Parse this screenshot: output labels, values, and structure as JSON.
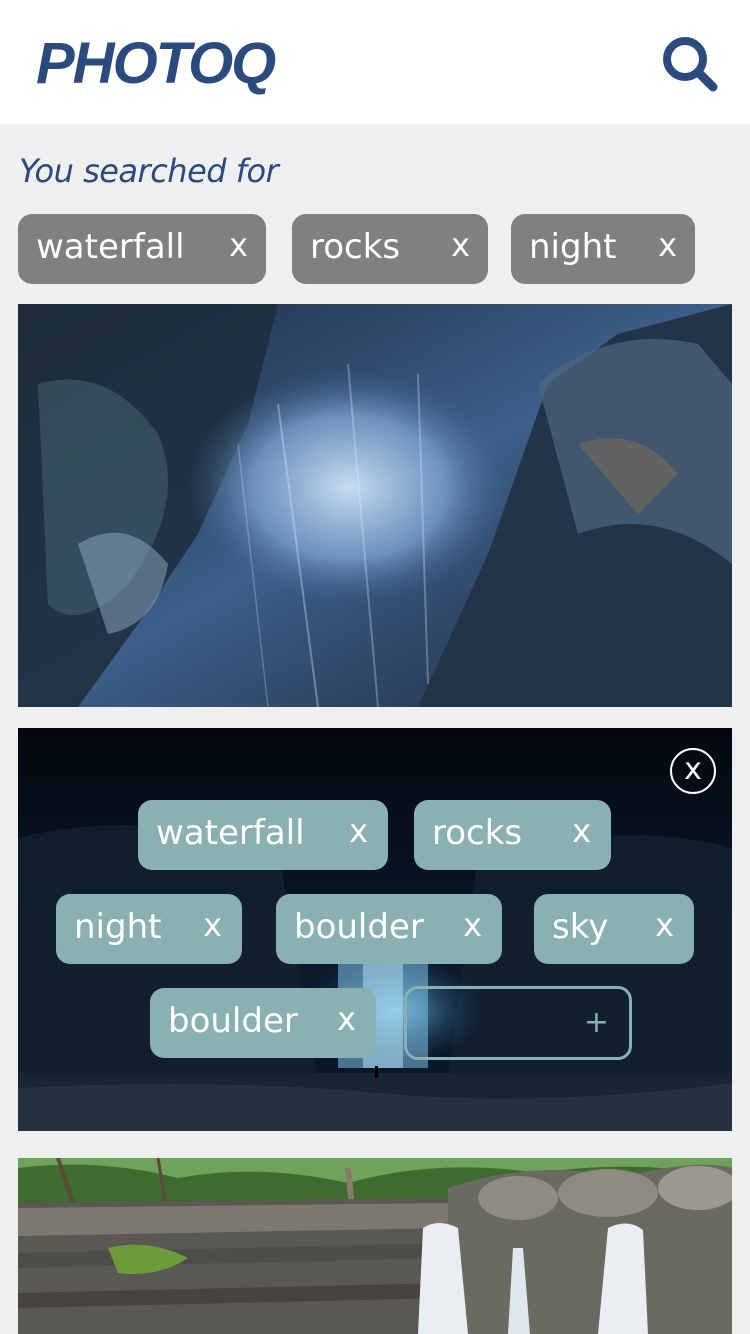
{
  "app": {
    "title": "PHOTOQ"
  },
  "header": {
    "search_icon": "search-icon"
  },
  "search": {
    "label": "You searched for",
    "terms": [
      {
        "label": "waterfall",
        "remove": "x"
      },
      {
        "label": "rocks",
        "remove": "x"
      },
      {
        "label": "night",
        "remove": "x"
      }
    ]
  },
  "editor": {
    "close": "x",
    "tags": [
      {
        "label": "waterfall",
        "remove": "x"
      },
      {
        "label": "rocks",
        "remove": "x"
      },
      {
        "label": "night",
        "remove": "x"
      },
      {
        "label": "boulder",
        "remove": "x"
      },
      {
        "label": "sky",
        "remove": "x"
      },
      {
        "label": "boulder",
        "remove": "x"
      }
    ],
    "add_value": "",
    "add_icon": "+"
  },
  "colors": {
    "brand": "#2b4a7e",
    "chip": "#808080",
    "tag": "#8ab0b2",
    "background": "#efefef"
  }
}
